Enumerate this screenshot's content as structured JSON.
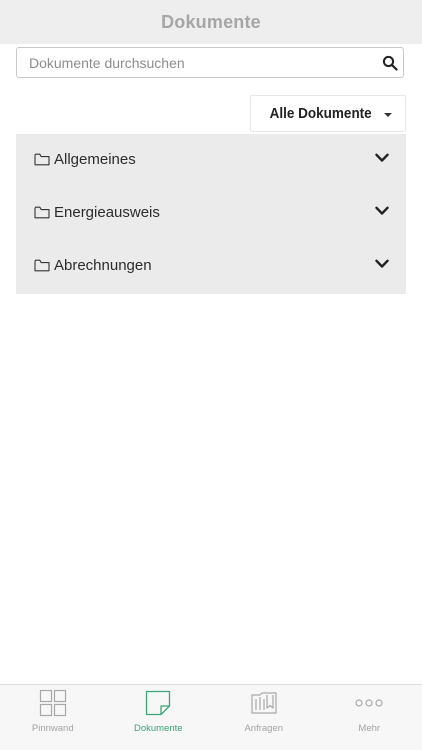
{
  "header": {
    "title": "Dokumente"
  },
  "search": {
    "placeholder": "Dokumente durchsuchen",
    "value": ""
  },
  "filter": {
    "label": "Alle Dokumente"
  },
  "folders": [
    {
      "label": "Allgemeines",
      "icon": "folder-icon"
    },
    {
      "label": "Energieausweis",
      "icon": "folder-icon"
    },
    {
      "label": "Abrechnungen",
      "icon": "folder-icon"
    }
  ],
  "tabbar": {
    "tabs": [
      {
        "label": "Pinnwand",
        "icon": "grid-icon",
        "active": false
      },
      {
        "label": "Dokumente",
        "icon": "document-icon",
        "active": true
      },
      {
        "label": "Anfragen",
        "icon": "requests-icon",
        "active": false
      },
      {
        "label": "Mehr",
        "icon": "more-icon",
        "active": false
      }
    ]
  },
  "colors": {
    "accent": "#3aa67a",
    "header_bg": "#eeeeee",
    "list_bg": "#ebebeb",
    "inactive": "#a3a3a3"
  }
}
